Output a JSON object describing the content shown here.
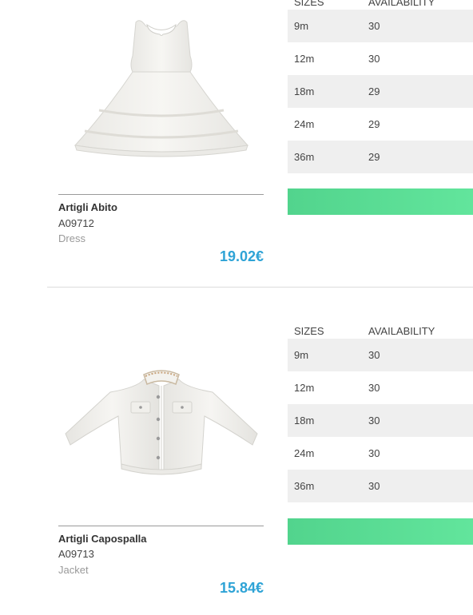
{
  "products": [
    {
      "name": "Artigli Abito",
      "code": "A09712",
      "category": "Dress",
      "price": "19.02€",
      "image_alt": "white sleeveless dress",
      "table": {
        "header_size": "SIZES",
        "header_availability": "AVAILABILITY",
        "rows": [
          {
            "size": "9m",
            "qty": "30"
          },
          {
            "size": "12m",
            "qty": "30"
          },
          {
            "size": "18m",
            "qty": "29"
          },
          {
            "size": "24m",
            "qty": "29"
          },
          {
            "size": "36m",
            "qty": "29"
          }
        ]
      },
      "button_label": ""
    },
    {
      "name": "Artigli Capospalla",
      "code": "A09713",
      "category": "Jacket",
      "price": "15.84€",
      "image_alt": "white denim jacket",
      "table": {
        "header_size": "SIZES",
        "header_availability": "AVAILABILITY",
        "rows": [
          {
            "size": "9m",
            "qty": "30"
          },
          {
            "size": "12m",
            "qty": "30"
          },
          {
            "size": "18m",
            "qty": "30"
          },
          {
            "size": "24m",
            "qty": "30"
          },
          {
            "size": "36m",
            "qty": "30"
          }
        ]
      },
      "button_label": ""
    }
  ],
  "colors": {
    "price": "#2ea3d6",
    "button": "#5bdc95",
    "row_alt": "#efefef"
  }
}
